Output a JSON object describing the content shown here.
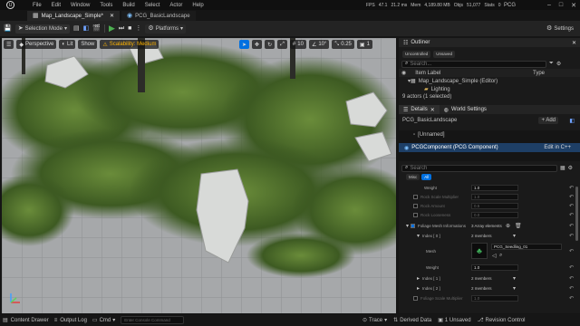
{
  "menu": {
    "items": [
      "File",
      "Edit",
      "Window",
      "Tools",
      "Build",
      "Select",
      "Actor",
      "Help"
    ]
  },
  "stats": {
    "fps_label": "FPS",
    "fps": "47.1",
    "ms": "21.2 ms",
    "mem_label": "Mem",
    "mem": "4,189.80 MB",
    "objs_label": "Objs",
    "objs": "51,077",
    "stats_label": "Stats",
    "stats_value": "0",
    "project": "PCG"
  },
  "tabs": [
    {
      "label": "Map_Landscape_Simple*"
    },
    {
      "label": "PCG_BasicLandscape"
    }
  ],
  "toolbar": {
    "save_label": "",
    "mode": "Selection Mode",
    "platforms": "Platforms",
    "settings": "Settings"
  },
  "viewport": {
    "perspective": "Perspective",
    "lit": "Lit",
    "show": "Show",
    "scalability": "Scalability: Medium",
    "grid": "10",
    "angle": "10°",
    "scale": "0.25",
    "cam": "1"
  },
  "outliner": {
    "title": "Outliner",
    "filters": [
      "Uncontrolled",
      "Unsaved"
    ],
    "search_placeholder": "Search...",
    "col_label": "Item Label",
    "col_type": "Type",
    "items": [
      "Map_Landscape_Simple (Editor)",
      "Lighting"
    ],
    "status": "9 actors (1 selected)"
  },
  "details": {
    "title": "Details",
    "world_settings": "World Settings",
    "actor_name": "PCG_BasicLandscape",
    "add_label": "+ Add",
    "tree": [
      "[Unnamed]",
      "PCGComponent (PCG Component)"
    ],
    "edit_cpp": "Edit in C++",
    "search_placeholder": "Search",
    "chips": [
      "Misc",
      "All"
    ]
  },
  "props": {
    "weight1_label": "Weight",
    "weight1": "1.0",
    "rock_scale_label": "Rock Scale Multiplier",
    "rock_scale": "1.0",
    "rock_amount_label": "Rock Amount",
    "rock_amount": "0.5",
    "rock_lean_label": "Rock Looseness",
    "rock_lean": "0.0",
    "foliage_label": "Foliage Mesh Informations",
    "foliage_val": "3 Array elements",
    "index0_label": "Index [ 0 ]",
    "index0_val": "2 members",
    "mesh_label": "Mesh",
    "mesh_val": "PCG_Seedling_01",
    "weight2_label": "Weight",
    "weight2": "1.0",
    "index1_label": "Index [ 1 ]",
    "index1_val": "2 members",
    "index2_label": "Index [ 2 ]",
    "index2_val": "2 members",
    "foliage_scale_label": "Foliage Scale Multiplier",
    "foliage_scale": "1.0"
  },
  "bottom": {
    "content_drawer": "Content Drawer",
    "output_log": "Output Log",
    "cmd": "Cmd",
    "console_placeholder": "Enter Console Command",
    "trace": "Trace",
    "derived": "Derived Data",
    "unsaved": "1 Unsaved",
    "revision": "Revision Control"
  },
  "colors": {
    "accent": "#0070e0",
    "play": "#4caf50",
    "selected_row": "#1e3f66",
    "warn": "#ffb400"
  }
}
